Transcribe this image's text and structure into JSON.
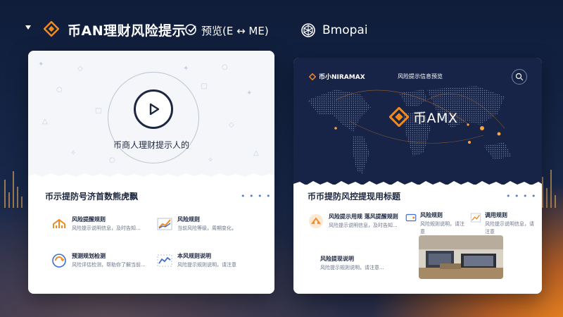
{
  "header": {
    "title": "币AN理财风险提示",
    "title_suffix": "预览(E ↔ ME)",
    "brand": "Bmopai",
    "collapse_icon": "caret-down-icon",
    "logo_icon": "diamond-logo-icon",
    "title_icon": "check-badge-icon",
    "brand_icon": "network-logo-icon"
  },
  "left_card": {
    "video_caption": "币商人理财提示人的",
    "play_icon": "play-icon",
    "section_title": "币示提防号济首数熊虎飘",
    "more": "• • • •",
    "features": [
      {
        "icon": "network-icon",
        "title": "风险提醒规则",
        "desc": "风险提示说明信息，及时告知..."
      },
      {
        "icon": "growth-chart-icon",
        "title": "风险规则",
        "desc": "当前风险等级，周期变化，"
      },
      {
        "icon": "refresh-icon",
        "title": "预测规划检测",
        "desc": "风险评估检测，帮助你了解当前..."
      },
      {
        "icon": "trend-line-icon",
        "title": "本风规则说明",
        "desc": "风险提示规则说明，请注意"
      }
    ]
  },
  "right_card": {
    "brand": "币小NIRAMAX",
    "title": "风险提示信息预览",
    "user_icon": "search-circle-icon",
    "center_brand": "币AMX",
    "section_title": "币币提防风控提现用标题",
    "more": "• • • •",
    "features": [
      {
        "icon": "network-icon",
        "title": "风险提示用规 落风提醒规则",
        "desc": "风险提示说明信息，及时告知..."
      },
      {
        "icon": "device-icon",
        "title": "风险规则",
        "desc": "风险规则说明，请注意"
      },
      {
        "icon": "chart-icon",
        "title": "调用规则",
        "desc": "风险提示说明信息，请注意"
      },
      {
        "icon": "none",
        "title": "风险提现说明",
        "desc": "风险提示规则说明，请注意..."
      }
    ]
  },
  "colors": {
    "accent": "#f0891e",
    "navy": "#172447",
    "text_dark": "#1d2840"
  }
}
